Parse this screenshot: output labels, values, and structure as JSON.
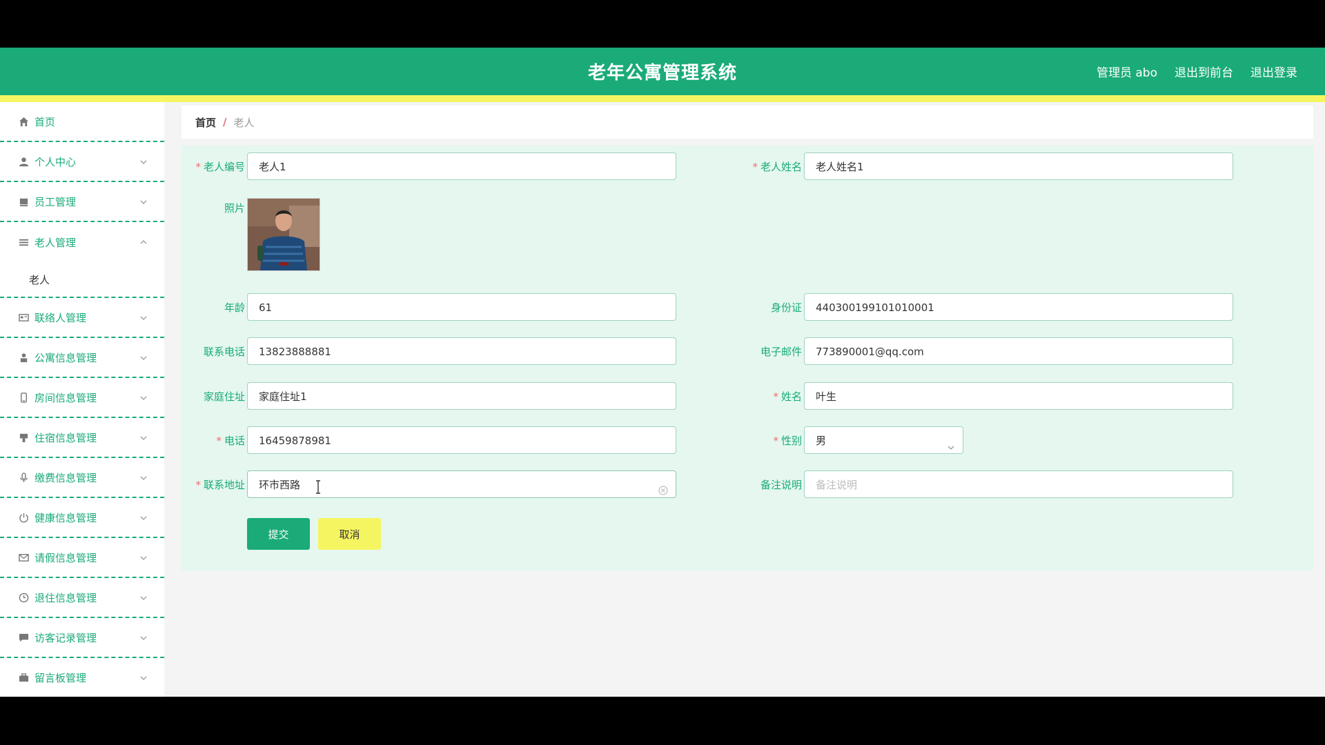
{
  "header": {
    "title": "老年公寓管理系统",
    "user": "管理员 abo",
    "to_front": "退出到前台",
    "logout": "退出登录"
  },
  "sidebar": {
    "items": [
      {
        "label": "首页",
        "icon": "home-icon"
      },
      {
        "label": "个人中心",
        "icon": "user-icon"
      },
      {
        "label": "员工管理",
        "icon": "staff-icon"
      },
      {
        "label": "老人管理",
        "icon": "list-icon",
        "expanded": true,
        "children": [
          "老人"
        ]
      },
      {
        "label": "联络人管理",
        "icon": "contact-card-icon"
      },
      {
        "label": "公寓信息管理",
        "icon": "person-icon"
      },
      {
        "label": "房间信息管理",
        "icon": "phone-icon"
      },
      {
        "label": "住宿信息管理",
        "icon": "bed-icon"
      },
      {
        "label": "缴费信息管理",
        "icon": "mic-icon"
      },
      {
        "label": "健康信息管理",
        "icon": "power-icon"
      },
      {
        "label": "请假信息管理",
        "icon": "mail-icon"
      },
      {
        "label": "退住信息管理",
        "icon": "clock-icon"
      },
      {
        "label": "访客记录管理",
        "icon": "chat-icon"
      },
      {
        "label": "留言板管理",
        "icon": "briefcase-icon"
      }
    ]
  },
  "breadcrumb": {
    "home": "首页",
    "sep": "/",
    "current": "老人"
  },
  "form": {
    "elder_no_label": "老人编号",
    "elder_no": "老人1",
    "elder_name_label": "老人姓名",
    "elder_name": "老人姓名1",
    "photo_label": "照片",
    "age_label": "年龄",
    "age": "61",
    "id_card_label": "身份证",
    "id_card": "440300199101010001",
    "phone_label": "联系电话",
    "phone": "13823888881",
    "email_label": "电子邮件",
    "email": "773890001@qq.com",
    "home_address_label": "家庭住址",
    "home_address": "家庭住址1",
    "name_label": "姓名",
    "name": "叶生",
    "tel_label": "电话",
    "tel": "16459878981",
    "gender_label": "性别",
    "gender": "男",
    "contact_address_label": "联系地址",
    "contact_address": "环市西路",
    "remark_label": "备注说明",
    "remark_placeholder": "备注说明",
    "submit": "提交",
    "cancel": "取消"
  },
  "colors": {
    "primary": "#1aab78",
    "accent": "#f5f562",
    "required": "#f56c6c",
    "panel": "#e5f7ef"
  }
}
